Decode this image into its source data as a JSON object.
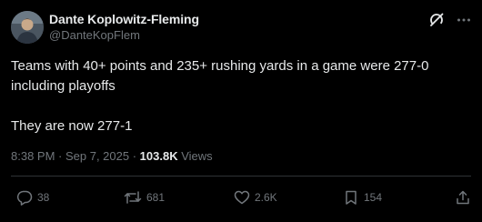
{
  "post": {
    "author": {
      "display_name": "Dante Koplowitz-Fleming",
      "handle": "@DanteKopFlem",
      "avatar_icon": "avatar-photo"
    },
    "text": {
      "line1": "Teams with 40+ points and 235+ rushing yards in a game were 277-0 including playoffs",
      "line2": "They are now 277-1"
    },
    "meta": {
      "time": "8:38 PM",
      "separator1": " · ",
      "date": "Sep 7, 2025",
      "separator2": " · ",
      "views_count": "103.8K",
      "views_label": " Views"
    },
    "engagement": {
      "replies": "38",
      "reposts": "681",
      "likes": "2.6K",
      "bookmarks": "154"
    },
    "icons": {
      "grok": "grok-icon",
      "more": "more-icon",
      "reply": "reply-icon",
      "repost": "repost-icon",
      "like": "heart-icon",
      "bookmark": "bookmark-icon",
      "share": "share-icon"
    }
  },
  "colors": {
    "background": "#000000",
    "primary_text": "#e7e9ea",
    "secondary_text": "#71767b",
    "divider": "#2f3336"
  }
}
